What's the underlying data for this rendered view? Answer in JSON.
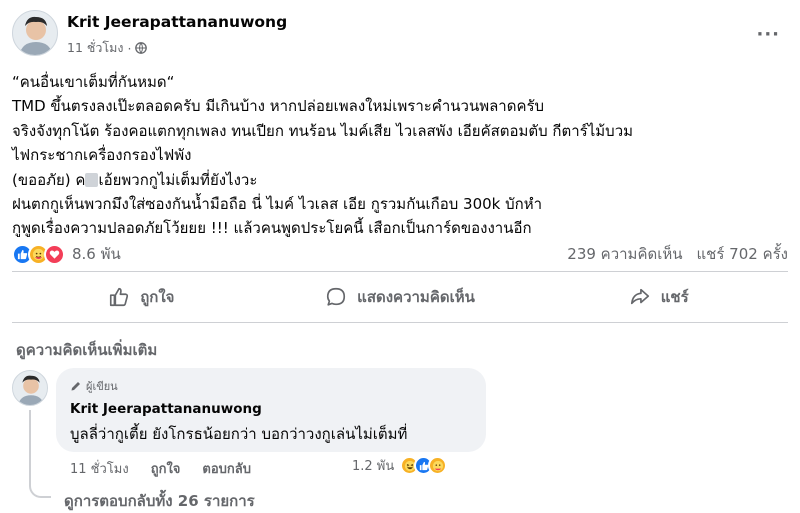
{
  "post": {
    "author": "Krit Jeerapattananuwong",
    "time": "11 ชั่วโมง",
    "lines": [
      "“คนอื่นเขาเต็มที่กันหมด“",
      "TMD ขึ้นตรงลงเป๊ะตลอดครับ มีเกินบ้าง หากปล่อยเพลงใหม่เพราะคำนวนพลาดครับ",
      "จริงจังทุกโน้ต ร้องคอแตกทุกเพลง ทนเปียก ทนร้อน ไมค์เสีย ไวเลสพัง เอียคัสตอมตับ กีตาร์ไม้บวม",
      "ไฟกระชากเครื่องกรองไฟพัง"
    ],
    "line5_prefix": "(ขออภัย) ค",
    "line5_suffix": "เอ้ยพวกกูไม่เต็มที่ยังไงวะ",
    "lines_after": [
      "ฝนตกกูเห็นพวกมึงใส่ซองกันน้ำมือถือ นี่ ไมค์ ไวเลส เอีย กูรวมกันเกือบ 300k บักหำ",
      "กูพูดเรื่องความปลอดภัยโว้ยยย !!! แล้วคนพูดประโยคนี้ เสือกเป็นการ์ดของงานอีก"
    ]
  },
  "stats": {
    "reaction_count": "8.6 พัน",
    "comments": "239 ความคิดเห็น",
    "shares": "แชร์ 702 ครั้ง"
  },
  "actions": {
    "like": "ถูกใจ",
    "comment": "แสดงความคิดเห็น",
    "share": "แชร์"
  },
  "more_comments": "ดูความคิดเห็นเพิ่มเติม",
  "comment": {
    "badge": "ผู้เขียน",
    "author": "Krit Jeerapattananuwong",
    "text": "บูลลี่ว่ากูเตี้ย ยังโกรธน้อยกว่า บอกว่าวงกูเล่นไม่เต็มที่",
    "time": "11 ชั่วโมง",
    "like": "ถูกใจ",
    "reply": "ตอบกลับ",
    "reaction_count": "1.2 พัน",
    "view_replies": "ดูการตอบกลับทั้ง 26 รายการ"
  },
  "icons": {
    "privacy": "globe-icon",
    "menu": "more-dots-icon",
    "like": "thumbs-up-icon",
    "comment": "speech-bubble-icon",
    "share": "share-arrow-icon",
    "badge": "pencil-icon"
  },
  "colors": {
    "like": "#1877f2",
    "care": "#f7b125",
    "love": "#f33e58",
    "muted_text": "#65676b",
    "bubble": "#f0f2f5"
  }
}
